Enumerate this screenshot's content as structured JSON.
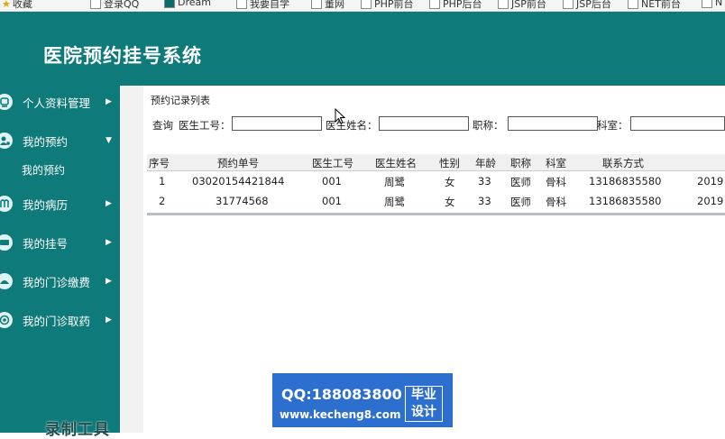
{
  "bookmarks": [
    {
      "label": "收藏",
      "icon": "star-icon"
    },
    {
      "label": "登录QQ",
      "icon": "qq-icon"
    },
    {
      "label": "Dream",
      "icon": "dreamweaver-icon"
    },
    {
      "label": "我要自学",
      "icon": "page-icon"
    },
    {
      "label": "董网",
      "icon": "page-icon"
    },
    {
      "label": "PHP前台",
      "icon": "page-icon"
    },
    {
      "label": "PHP后台",
      "icon": "page-icon"
    },
    {
      "label": "JSP前台",
      "icon": "page-icon"
    },
    {
      "label": "JSP后台",
      "icon": "page-icon"
    },
    {
      "label": "NET前台",
      "icon": "page-icon"
    },
    {
      "label": "N",
      "icon": "page-icon"
    }
  ],
  "header": {
    "title": "医院预约挂号系统"
  },
  "sidebar": {
    "items": [
      {
        "label": "个人资料管理",
        "icon": "user-profile-icon",
        "arrow": "▶"
      },
      {
        "label": "我的预约",
        "icon": "appointment-icon",
        "arrow": "▼",
        "sub": [
          "我的预约"
        ]
      },
      {
        "label": "我的病历",
        "icon": "medical-record-icon",
        "arrow": "▶"
      },
      {
        "label": "我的挂号",
        "icon": "registration-icon",
        "arrow": "▶"
      },
      {
        "label": "我的门诊缴费",
        "icon": "payment-icon",
        "arrow": "▶"
      },
      {
        "label": "我的门诊取药",
        "icon": "medicine-icon",
        "arrow": "▶"
      }
    ]
  },
  "recorder_text": "录制工具",
  "panel": {
    "title": "预约记录列表",
    "search": {
      "query_label": "查询",
      "doctor_id_label": "医生工号：",
      "doctor_name_label": "医生姓名：",
      "title_label": "职称：",
      "department_label": "科室：",
      "doctor_id_value": "",
      "doctor_name_value": "",
      "title_value": "",
      "department_value": ""
    }
  },
  "table": {
    "columns": [
      "序号",
      "预约单号",
      "医生工号",
      "医生姓名",
      "性别",
      "年龄",
      "职称",
      "科室",
      "联系方式",
      ""
    ],
    "rows": [
      [
        "1",
        "03020154421844",
        "001",
        "周鹭",
        "女",
        "33",
        "医师",
        "骨科",
        "13186835580",
        "2019"
      ],
      [
        "2",
        "31774568",
        "001",
        "周鹭",
        "女",
        "33",
        "医师",
        "骨科",
        "13186835580",
        "2019"
      ]
    ]
  },
  "watermark": {
    "qq": "QQ:188083800",
    "site": "www.kecheng8.com",
    "badge_line1": "毕业",
    "badge_line2": "设计"
  },
  "colors": {
    "sidebar": "#0f7a7a",
    "watermark": "#2d6fcf"
  }
}
